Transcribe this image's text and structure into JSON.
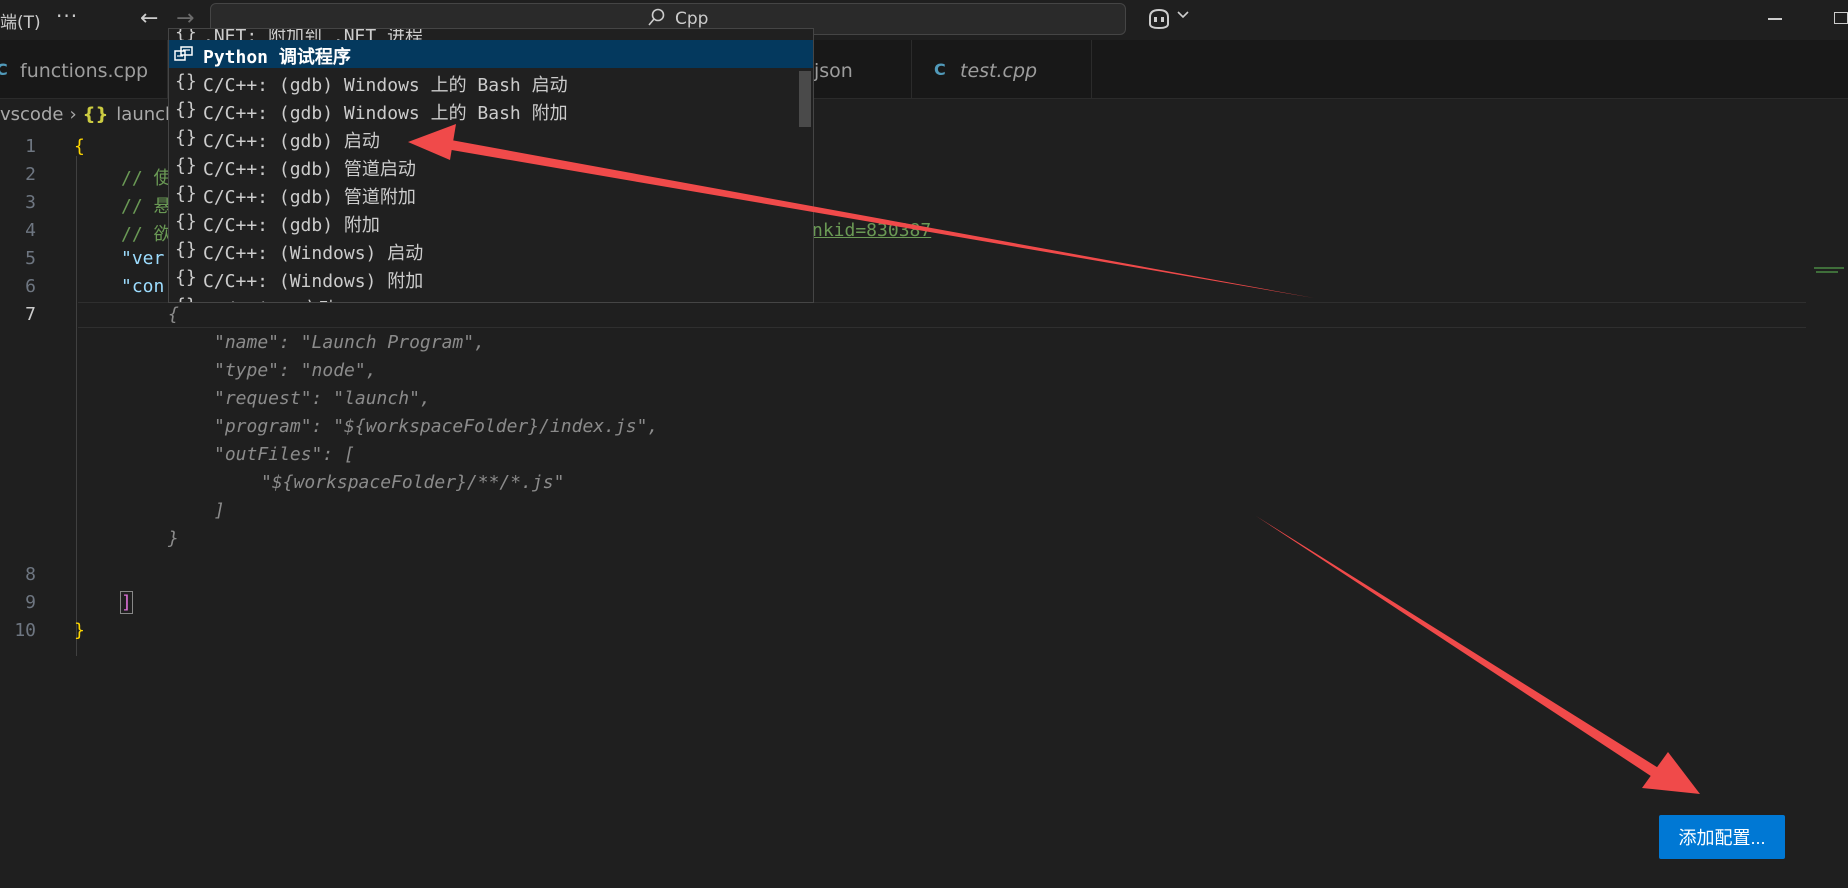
{
  "titlebar": {
    "menu_terminal": "端(T)",
    "more": "···",
    "search_text": "Cpp"
  },
  "tabs": [
    {
      "icon": "cpp-file-icon",
      "icon_glyph": "C",
      "label": "functions.cpp",
      "italic": false
    },
    {
      "icon": "json-file-icon",
      "icon_glyph": "",
      "label": "s.json",
      "italic": false
    },
    {
      "icon": "cpp-file-icon",
      "icon_glyph": "C",
      "label": "test.cpp",
      "italic": true
    }
  ],
  "breadcrumb": {
    "folder": "vscode",
    "braces": "{}",
    "file": "launch"
  },
  "editor": {
    "line_numbers": [
      "1",
      "2",
      "3",
      "4",
      "5",
      "6",
      "7",
      "8",
      "9",
      "10"
    ],
    "active_line": "7",
    "lines": {
      "l1": "{",
      "l2": "// 使",
      "l3": "// 悬",
      "l4": "// 欲",
      "l4_link": "nkid=830387",
      "l5": "\"ver",
      "l6": "\"con",
      "l7": "{",
      "g1": "\"name\": \"Launch Program\",",
      "g2": "\"type\": \"node\",",
      "g3": "\"request\": \"launch\",",
      "g4": "\"program\": \"${workspaceFolder}/index.js\",",
      "g5": "\"outFiles\": [",
      "g6": "\"${workspaceFolder}/**/*.js\"",
      "g7": "]",
      "g8": "}",
      "l9": "]",
      "l10": "}"
    }
  },
  "suggest": {
    "items": [
      {
        "icon": "{}",
        "label": ".NET: 附加到 .NET 进程",
        "selected": false
      },
      {
        "icon": "debug-icon",
        "label": "Python 调试程序",
        "selected": true
      },
      {
        "icon": "{}",
        "label": "C/C++: (gdb) Windows 上的 Bash 启动",
        "selected": false
      },
      {
        "icon": "{}",
        "label": "C/C++: (gdb) Windows 上的 Bash 附加",
        "selected": false
      },
      {
        "icon": "{}",
        "label": "C/C++: (gdb) 启动",
        "selected": false
      },
      {
        "icon": "{}",
        "label": "C/C++: (gdb) 管道启动",
        "selected": false
      },
      {
        "icon": "{}",
        "label": "C/C++: (gdb) 管道附加",
        "selected": false
      },
      {
        "icon": "{}",
        "label": "C/C++: (gdb) 附加",
        "selected": false
      },
      {
        "icon": "{}",
        "label": "C/C++: (Windows) 启动",
        "selected": false
      },
      {
        "icon": "{}",
        "label": "C/C++: (Windows) 附加",
        "selected": false
      },
      {
        "icon": "{}",
        "label": "Node.js: 启动",
        "selected": false
      }
    ]
  },
  "add_config_button": "添加配置...",
  "colors": {
    "accent": "#0078d4",
    "selection": "#04395e",
    "annotation_arrow": "#f04a4a",
    "comment": "#6a9955",
    "key": "#9cdcfe",
    "brace": "#ffd700"
  }
}
